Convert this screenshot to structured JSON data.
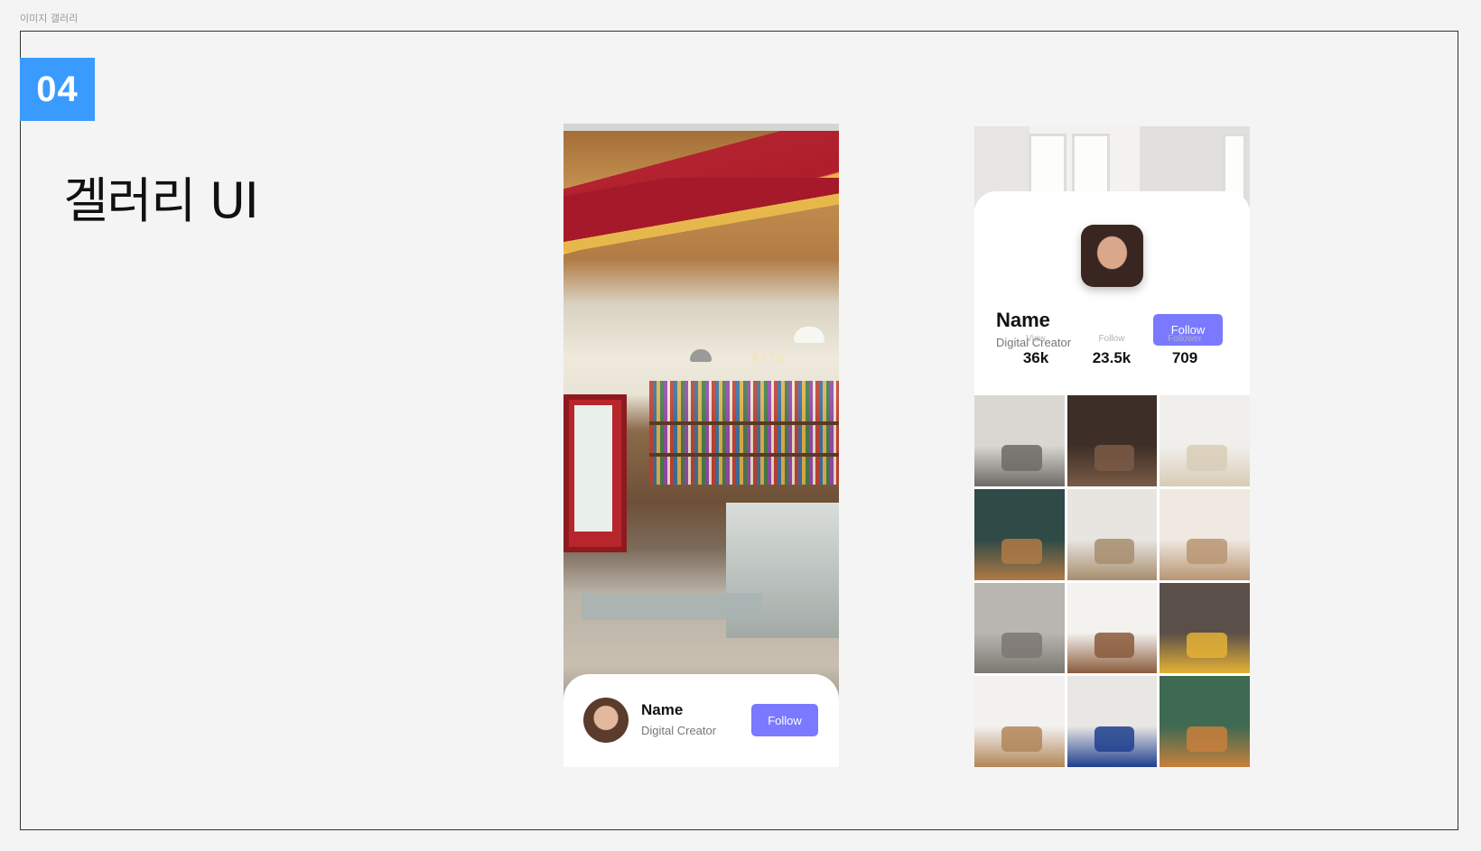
{
  "page": {
    "label": "이미지 갤러리"
  },
  "section": {
    "number": "04",
    "title": "겔러리 UI"
  },
  "phone1": {
    "sign_text": "Asia",
    "profile": {
      "name": "Name",
      "role": "Digital Creator",
      "follow_label": "Follow"
    }
  },
  "phone2": {
    "profile": {
      "name": "Name",
      "role": "Digital Creator",
      "follow_label": "Follow"
    },
    "stats": [
      {
        "label": "View",
        "value": "36k"
      },
      {
        "label": "Follow",
        "value": "23.5k"
      },
      {
        "label": "Follower",
        "value": "709"
      }
    ],
    "gallery_tiles": [
      {
        "name": "arched-hallway",
        "colors": [
          "#d9d7d2",
          "#6d6a66"
        ]
      },
      {
        "name": "dark-fireplace-room",
        "colors": [
          "#3d2f28",
          "#7a5a45"
        ]
      },
      {
        "name": "wicker-chair",
        "colors": [
          "#f1efec",
          "#d8ccb6"
        ]
      },
      {
        "name": "green-wall-living-room",
        "colors": [
          "#2f4a47",
          "#b07a45"
        ]
      },
      {
        "name": "window-lounge",
        "colors": [
          "#e8e5e0",
          "#a78e6e"
        ]
      },
      {
        "name": "round-mirror-room",
        "colors": [
          "#efe9e2",
          "#b89572"
        ]
      },
      {
        "name": "grey-staircase",
        "colors": [
          "#b9b6b1",
          "#7b7771"
        ]
      },
      {
        "name": "white-desk-cactus",
        "colors": [
          "#f3f2ef",
          "#8a5a3b"
        ]
      },
      {
        "name": "yellow-chairs",
        "colors": [
          "#5a4f49",
          "#e5b236"
        ]
      },
      {
        "name": "modern-kitchen",
        "colors": [
          "#f2f1ef",
          "#b28658"
        ]
      },
      {
        "name": "blue-sofa-wall-art",
        "colors": [
          "#e9e7e3",
          "#1f3f8f"
        ]
      },
      {
        "name": "portrait-painting-room",
        "colors": [
          "#3f6a52",
          "#c97f3c"
        ]
      }
    ]
  }
}
